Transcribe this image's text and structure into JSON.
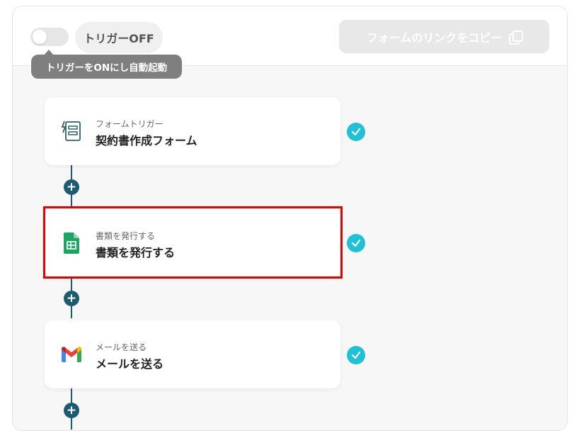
{
  "header": {
    "trigger_status": "トリガーOFF",
    "tooltip": "トリガーをONにし自動起動",
    "copy_link_button": "フォームのリンクをコピー"
  },
  "steps": [
    {
      "subtitle": "フォームトリガー",
      "title": "契約書作成フォーム",
      "icon": "form-trigger-icon"
    },
    {
      "subtitle": "書類を発行する",
      "title": "書類を発行する",
      "icon": "google-sheets-icon"
    },
    {
      "subtitle": "メールを送る",
      "title": "メールを送る",
      "icon": "gmail-icon"
    }
  ],
  "colors": {
    "connector": "#1c5c73",
    "check": "#1fc1d6",
    "highlight": "#e60000"
  }
}
